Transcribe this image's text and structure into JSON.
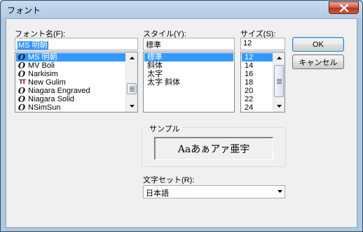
{
  "window": {
    "title": "フォント"
  },
  "font": {
    "label": "フォント名(F):",
    "value": "MS 明朝",
    "items": [
      {
        "label": "MS 明朝",
        "icon": "opentype-icon",
        "selected": true
      },
      {
        "label": "MV Boli",
        "icon": "opentype-icon",
        "selected": false
      },
      {
        "label": "Narkisim",
        "icon": "opentype-icon",
        "selected": false
      },
      {
        "label": "New Gulim",
        "icon": "truetype-icon",
        "selected": false
      },
      {
        "label": "Niagara Engraved",
        "icon": "opentype-icon",
        "selected": false
      },
      {
        "label": "Niagara Solid",
        "icon": "opentype-icon",
        "selected": false
      },
      {
        "label": "NSimSun",
        "icon": "opentype-icon",
        "selected": false
      }
    ]
  },
  "style": {
    "label": "スタイル(Y):",
    "value": "標準",
    "items": [
      {
        "label": "標準",
        "selected": true
      },
      {
        "label": "斜体",
        "selected": false
      },
      {
        "label": "太字",
        "selected": false
      },
      {
        "label": "太字 斜体",
        "selected": false
      }
    ]
  },
  "size": {
    "label": "サイズ(S):",
    "value": "12",
    "items": [
      {
        "label": "12",
        "selected": true
      },
      {
        "label": "14",
        "selected": false
      },
      {
        "label": "16",
        "selected": false
      },
      {
        "label": "18",
        "selected": false
      },
      {
        "label": "20",
        "selected": false
      },
      {
        "label": "22",
        "selected": false
      },
      {
        "label": "24",
        "selected": false
      }
    ]
  },
  "buttons": {
    "ok": "OK",
    "cancel": "キャンセル"
  },
  "sample": {
    "label": "サンプル",
    "text": "Aaあぁアァ亜宇"
  },
  "charset": {
    "label": "文字セット(R):",
    "value": "日本語"
  },
  "colors": {
    "selection": "#3399ff",
    "close_button": "#c7432a",
    "dialog_bg": "#f0f0f0"
  }
}
